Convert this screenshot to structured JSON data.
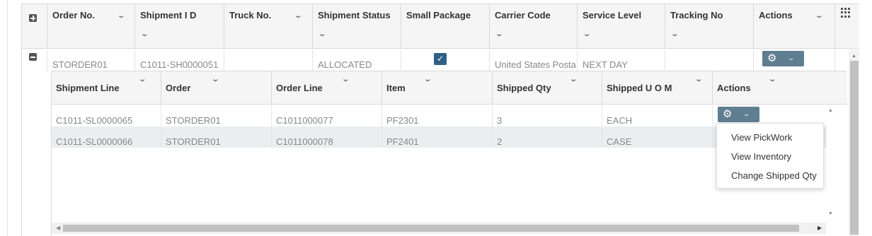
{
  "parent_grid": {
    "columns": [
      {
        "label": "Order No."
      },
      {
        "label": "Shipment I D"
      },
      {
        "label": "Truck No."
      },
      {
        "label": "Shipment Status"
      },
      {
        "label": "Small Package"
      },
      {
        "label": "Carrier Code"
      },
      {
        "label": "Service Level"
      },
      {
        "label": "Tracking No"
      },
      {
        "label": "Actions"
      }
    ],
    "row": {
      "order_no": "STORDER01",
      "shipment_id": "C1011-SH0000051",
      "truck_no": "",
      "shipment_status": "ALLOCATED",
      "small_package": true,
      "carrier_code": "United States Posta",
      "service_level": "NEXT DAY",
      "tracking_no": ""
    }
  },
  "detail_grid": {
    "columns": [
      {
        "label": "Shipment Line"
      },
      {
        "label": "Order"
      },
      {
        "label": "Order Line"
      },
      {
        "label": "Item"
      },
      {
        "label": "Shipped Qty"
      },
      {
        "label": "Shipped U O M"
      },
      {
        "label": "Actions"
      }
    ],
    "rows": [
      {
        "shipment_line": "C1011-SL0000065",
        "order": "STORDER01",
        "order_line": "C1011000077",
        "item": "PF2301",
        "shipped_qty": "3",
        "shipped_uom": "EACH"
      },
      {
        "shipment_line": "C1011-SL0000066",
        "order": "STORDER01",
        "order_line": "C1011000078",
        "item": "PF2401",
        "shipped_qty": "2",
        "shipped_uom": "CASE"
      }
    ]
  },
  "actions_menu": {
    "items": [
      "View PickWork",
      "View Inventory",
      "Change Shipped Qty"
    ]
  },
  "icons": {
    "gear": "⚙",
    "chevron_down": "⌄",
    "checkmark": "✓"
  },
  "colors": {
    "action_button": "#5f7e91",
    "checkbox": "#2f5f86",
    "alt_row": "#eaeef1"
  }
}
